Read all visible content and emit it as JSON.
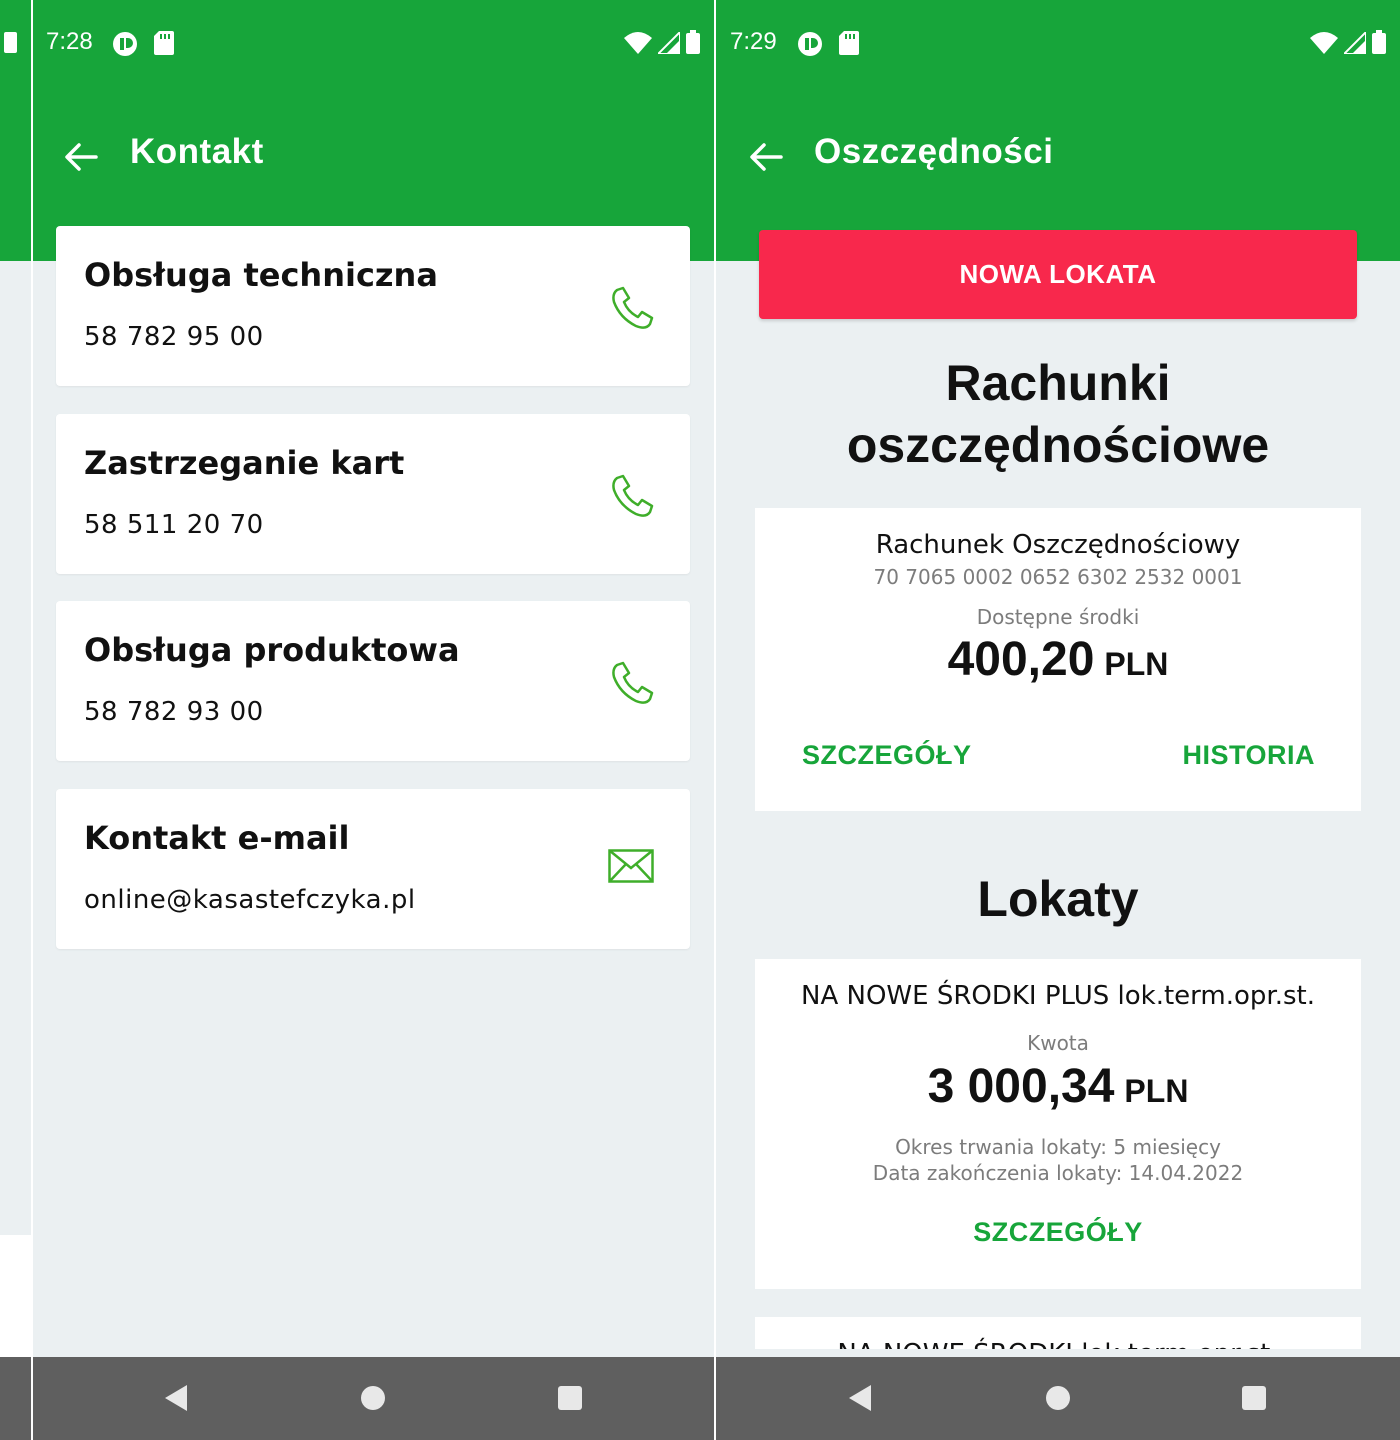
{
  "colors": {
    "brand_green": "#17a53a",
    "accent_red": "#f8284c",
    "background": "#ebf0f2",
    "navbar": "#5f5f5f"
  },
  "left_screen": {
    "status_bar": {
      "time": "7:28",
      "icons": [
        "notification-icon",
        "sd-card-icon",
        "wifi-icon",
        "signal-icon",
        "battery-icon"
      ]
    },
    "header": {
      "title": "Kontakt"
    },
    "contacts": [
      {
        "title": "Obsługa techniczna",
        "value": "58 782 95 00",
        "icon": "phone-icon"
      },
      {
        "title": "Zastrzeganie kart",
        "value": "58 511 20 70",
        "icon": "phone-icon"
      },
      {
        "title": "Obsługa produktowa",
        "value": "58 782 93 00",
        "icon": "phone-icon"
      },
      {
        "title": "Kontakt e-mail",
        "value": "online@kasastefczyka.pl",
        "icon": "mail-icon"
      }
    ]
  },
  "right_screen": {
    "status_bar": {
      "time": "7:29",
      "icons": [
        "notification-icon",
        "sd-card-icon",
        "wifi-icon",
        "signal-icon",
        "battery-icon"
      ]
    },
    "header": {
      "title": "Oszczędności"
    },
    "new_deposit_button": "NOWA LOKATA",
    "savings_heading_line1": "Rachunki",
    "savings_heading_line2": "oszczędnościowe",
    "savings_account": {
      "name": "Rachunek Oszczędnościowy",
      "number": "70 7065 0002 0652 6302 2532 0001",
      "balance_label": "Dostępne środki",
      "balance_amount": "400,20",
      "currency": "PLN",
      "details_link": "SZCZEGÓŁY",
      "history_link": "HISTORIA"
    },
    "deposits_heading": "Lokaty",
    "deposit": {
      "name": "NA NOWE ŚRODKI PLUS lok.term.opr.st.",
      "amount_label": "Kwota",
      "amount": "3 000,34",
      "currency": "PLN",
      "duration": "Okres trwania lokaty: 5 miesięcy",
      "end_date": "Data zakończenia lokaty: 14.04.2022",
      "details_link": "SZCZEGÓŁY"
    },
    "next_deposit_partial": "NA NOWE ŚRODKI lok.term.opr.st."
  },
  "navbar": {
    "buttons": [
      "back-nav-icon",
      "home-nav-icon",
      "recents-nav-icon"
    ]
  }
}
